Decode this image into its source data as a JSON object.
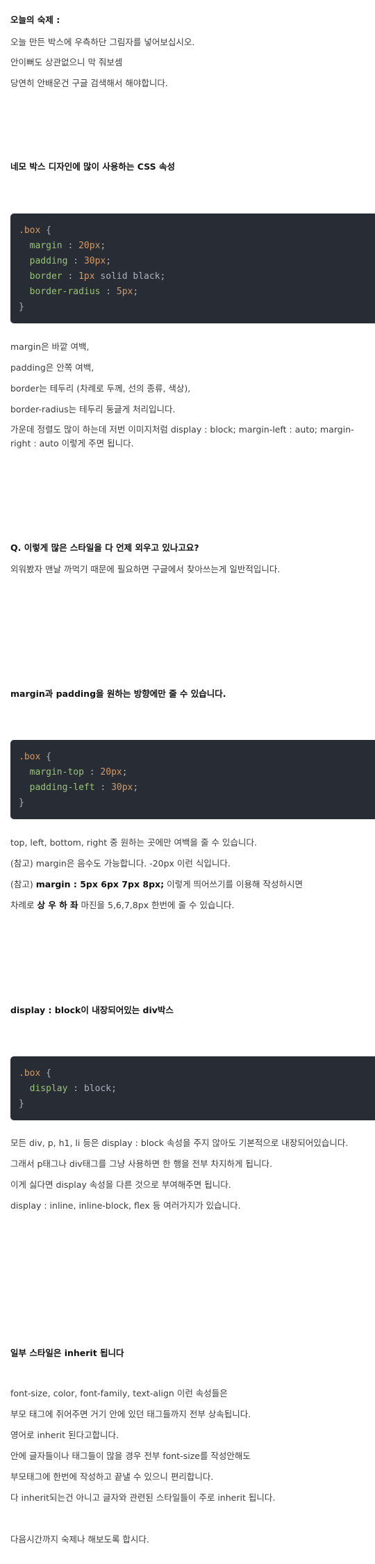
{
  "homework": {
    "title": "오늘의 숙제 :",
    "lines": [
      "오늘 만든 박스에 우측하단 그림자를 넣어보십시오.",
      "안이뻐도 상관없으니 막 줘보셈",
      "당연히 안배운건 구글 검색해서 해야합니다."
    ]
  },
  "section1": {
    "heading": "네모 박스 디자인에 많이 사용하는 CSS 속성",
    "code": {
      "selector": ".box",
      "open": "{",
      "close": "}",
      "props": [
        {
          "name": "margin",
          "sep": " : ",
          "num": "20px",
          "rest": ";"
        },
        {
          "name": "padding",
          "sep": " : ",
          "num": "30px",
          "rest": ";"
        },
        {
          "name": "border",
          "sep": " : ",
          "num": "1px",
          "rest": " solid black;"
        },
        {
          "name": "border-radius",
          "sep": " : ",
          "num": "5px",
          "rest": ";"
        }
      ]
    },
    "notes": [
      "margin은 바깥 여백,",
      "padding은 안쪽 여백,",
      "border는 테두리 (차례로 두께, 선의 종류, 색상),",
      "border-radius는 테두리 둥글게 처리입니다.",
      "가운데 정렬도 많이 하는데 저번 이미지처럼 display : block; margin-left : auto; margin-right : auto 이렇게 주면 됩니다."
    ]
  },
  "qa": {
    "question": "Q. 이렇게 많은 스타일을 다 언제 외우고 있나고요?",
    "answer": "외워봤자 맨날 까먹기 때문에 필요하면 구글에서 찾아쓰는게 일반적입니다."
  },
  "section2": {
    "heading": "margin과 padding을 원하는 방향에만 줄 수 있습니다.",
    "code": {
      "selector": ".box",
      "open": "{",
      "close": "}",
      "props": [
        {
          "name": "margin-top",
          "sep": " : ",
          "num": "20px",
          "rest": ";"
        },
        {
          "name": "padding-left",
          "sep": " : ",
          "num": "30px",
          "rest": ";"
        }
      ]
    },
    "notes": [
      "top, left, bottom, right 중 원하는 곳에만 여백을 줄 수 있습니다.",
      "(참고) margin은 음수도 가능합니다. -20px 이런 식입니다."
    ],
    "note3": {
      "pre": "(참고) ",
      "bold": "margin : 5px 6px 7px 8px;",
      "post": " 이렇게 띄어쓰기를 이용해 작성하시면"
    },
    "note4": {
      "pre": "차례로 ",
      "bold": "상 우 하 좌",
      "post": " 마진을 5,6,7,8px 한번에 줄 수 있습니다."
    }
  },
  "section3": {
    "heading": "display : block이 내장되어있는 div박스",
    "code": {
      "selector": ".box",
      "open": "{",
      "close": "}",
      "props": [
        {
          "name": "display",
          "sep": " : ",
          "num": "",
          "rest": "block;"
        }
      ]
    },
    "notes": [
      "모든 div, p, h1, li 등은 display : block 속성을 주지 않아도 기본적으로 내장되어있습니다.",
      "그래서 p태그나 div태그를 그냥 사용하면 한 행을 전부 차지하게 됩니다.",
      "이게 싫다면 display 속성을 다른 것으로 부여해주면 됩니다.",
      "display : inline, inline-block, flex 등 여러가지가 있습니다."
    ]
  },
  "section4": {
    "heading": "일부 스타일은 inherit 됩니다",
    "notes": [
      "font-size, color, font-family, text-align 이런 속성들은",
      "부모 태그에 쥐어주면 거기 안에 있던 태그들까지 전부 상속됩니다.",
      "영어로 inherit 된다고합니다.",
      "안에 글자들이나 태그들이 많을 경우 전부 font-size를 작성안해도",
      "부모태그에 한번에 작성하고 끝낼 수 있으니 편리합니다.",
      "다 inherit되는건 아니고 글자와 관련된 스타일들이 주로 inherit 됩니다."
    ],
    "closing": "다음시간까지 숙제나 해보도록 합시다."
  }
}
